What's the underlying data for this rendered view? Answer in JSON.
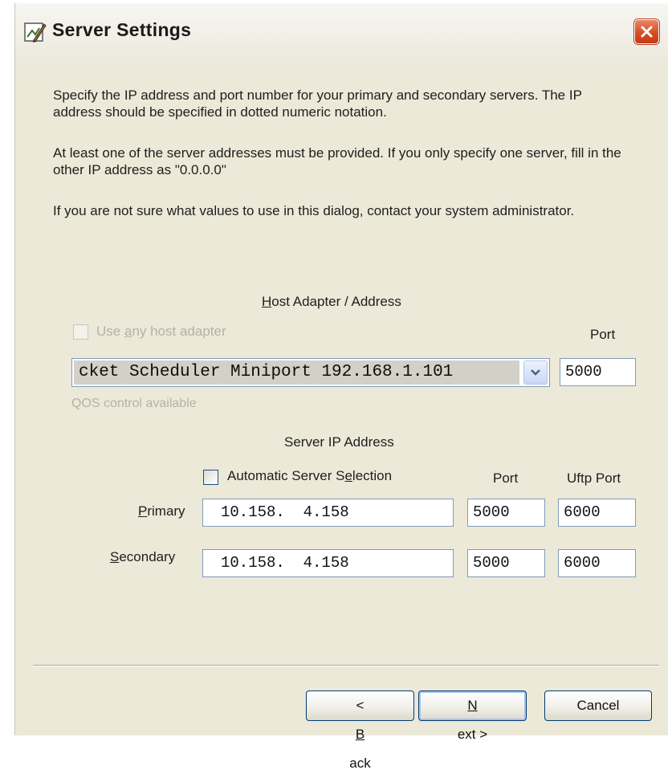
{
  "window": {
    "title": "Server Settings"
  },
  "instructions": {
    "p1": "Specify the IP address and port number for your primary and secondary servers. The IP address should be specified in dotted numeric notation.",
    "p2": "At least one of the server addresses must be provided. If you only specify one server, fill in the other IP address as \"0.0.0.0\"",
    "p3": "If you are not sure what values to use in this dialog, contact your system administrator."
  },
  "host_adapter": {
    "heading_mnemonic": "H",
    "heading_rest": "ost Adapter / Address",
    "use_any_pre": "Use ",
    "use_any_mnemonic": "a",
    "use_any_post": "ny host adapter",
    "use_any_checked": false,
    "port_label": "Port",
    "selected_adapter": "cket Scheduler Miniport 192.168.1.101",
    "port_value": "5000",
    "qos_label": "QOS control available"
  },
  "server_ip": {
    "heading": "Server IP Address",
    "auto_pre": "Automatic Server S",
    "auto_mnemonic": "e",
    "auto_post": "lection",
    "auto_checked": false,
    "port_col": "Port",
    "uftp_col": "Uftp Port",
    "primary": {
      "label_mnemonic": "P",
      "label_rest": "rimary",
      "ip": "10.158.  4.158",
      "port": "5000",
      "uftp_port": "6000"
    },
    "secondary": {
      "label_mnemonic": "S",
      "label_rest": "econdary",
      "ip": "10.158.  4.158",
      "port": "5000",
      "uftp_port": "6000"
    }
  },
  "buttons": {
    "back_pre": "< ",
    "back_mnemonic": "B",
    "back_post": "ack",
    "next_mnemonic": "N",
    "next_post": "ext >",
    "cancel": "Cancel"
  },
  "icons": {
    "title": "wizard-pen-icon",
    "close": "close-icon",
    "dropdown": "chevron-down-icon"
  },
  "colors": {
    "close_button": "#d94d26",
    "dialog_face": "#ece9d8",
    "field_border": "#7f9db9"
  }
}
